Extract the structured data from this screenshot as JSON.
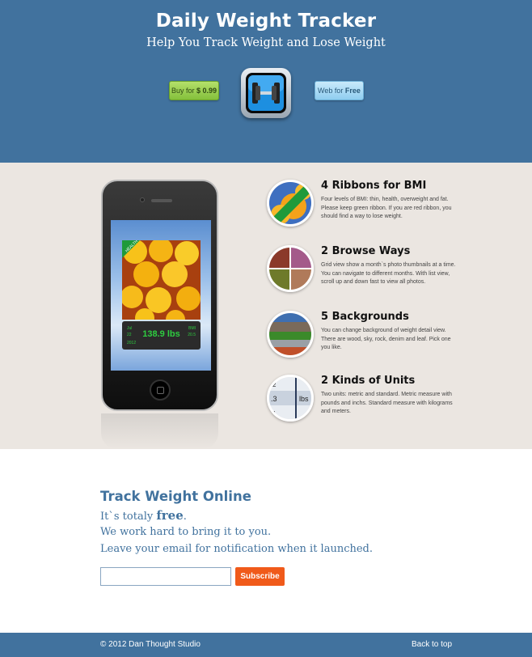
{
  "header": {
    "title": "Daily Weight Tracker",
    "subtitle": "Help You Track Weight and Lose Weight",
    "buy_prefix": "Buy for",
    "buy_price": "$ 0.99",
    "web_prefix": "Web for",
    "web_price": "Free"
  },
  "phone_screen": {
    "weight": "138.9 lbs",
    "month": "Jul",
    "day": "22",
    "year": "2012",
    "bmi_label": "BMI",
    "bmi_value": "20.5",
    "ribbon": "HEALTH"
  },
  "features": [
    {
      "title": "4 Ribbons for BMI",
      "desc": "Four levels of BMI: thin, health, overweight and fat. Please keep green ribbon. If you are red ribbon, you should find a way to lose weight."
    },
    {
      "title": "2 Browse Ways",
      "desc": "Grid view show a month`s photo thumbnails at a time. You can navigate to different months. With list view, scroll up and down fast to view all photos."
    },
    {
      "title": "5 Backgrounds",
      "desc": "You can change background of weight detail view. There are wood, sky, rock, denim and leaf. Pick one you like."
    },
    {
      "title": "2 Kinds of Units",
      "desc": "Two units: metric and standard. Metric measure with pounds and inchs. Standard measure with kilograms and meters.",
      "icon_text": [
        "2",
        ".3",
        "lbs",
        "1"
      ]
    }
  ],
  "signup": {
    "title": "Track Weight Online",
    "line1_prefix": "It`s totaly ",
    "line1_bold": "free",
    "line1_suffix": ".",
    "line2": "We work hard to bring it to you.",
    "line3": "Leave your email for notification when it launched.",
    "email_placeholder": "",
    "subscribe_label": "Subscribe"
  },
  "footer": {
    "copyright": "© 2012 Dan Thought Studio",
    "back_to_top": "Back to top"
  },
  "colors": {
    "brand_blue": "#41729e",
    "section_beige": "#ebe6e1",
    "subscribe_orange": "#f05a1a",
    "buy_green": "#9ad152",
    "web_blue": "#a9dcf5"
  },
  "icons": [
    "dumbbell-app-icon",
    "ribbon-oranges-icon",
    "photo-grid-icon",
    "backgrounds-icon",
    "units-scale-icon",
    "home-button-icon"
  ]
}
